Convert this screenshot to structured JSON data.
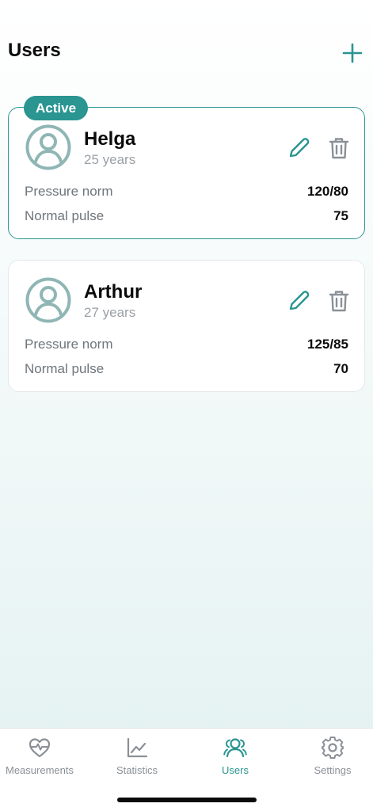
{
  "header": {
    "title": "Users",
    "add_icon": "plus-icon"
  },
  "colors": {
    "accent": "#2a9591",
    "avatar": "#8fb6b4",
    "muted": "#8a9096",
    "delete": "#8a9096"
  },
  "users": [
    {
      "badge": "Active",
      "name": "Helga",
      "age": "25 years",
      "pressure_label": "Pressure norm",
      "pressure_value": "120/80",
      "pulse_label": "Normal pulse",
      "pulse_value": "75"
    },
    {
      "name": "Arthur",
      "age": "27 years",
      "pressure_label": "Pressure norm",
      "pressure_value": "125/85",
      "pulse_label": "Normal pulse",
      "pulse_value": "70"
    }
  ],
  "tabs": [
    {
      "label": "Measurements",
      "icon": "heart-pulse-icon",
      "selected": false
    },
    {
      "label": "Statistics",
      "icon": "chart-line-icon",
      "selected": false
    },
    {
      "label": "Users",
      "icon": "users-icon",
      "selected": true
    },
    {
      "label": "Settings",
      "icon": "gear-icon",
      "selected": false
    }
  ]
}
